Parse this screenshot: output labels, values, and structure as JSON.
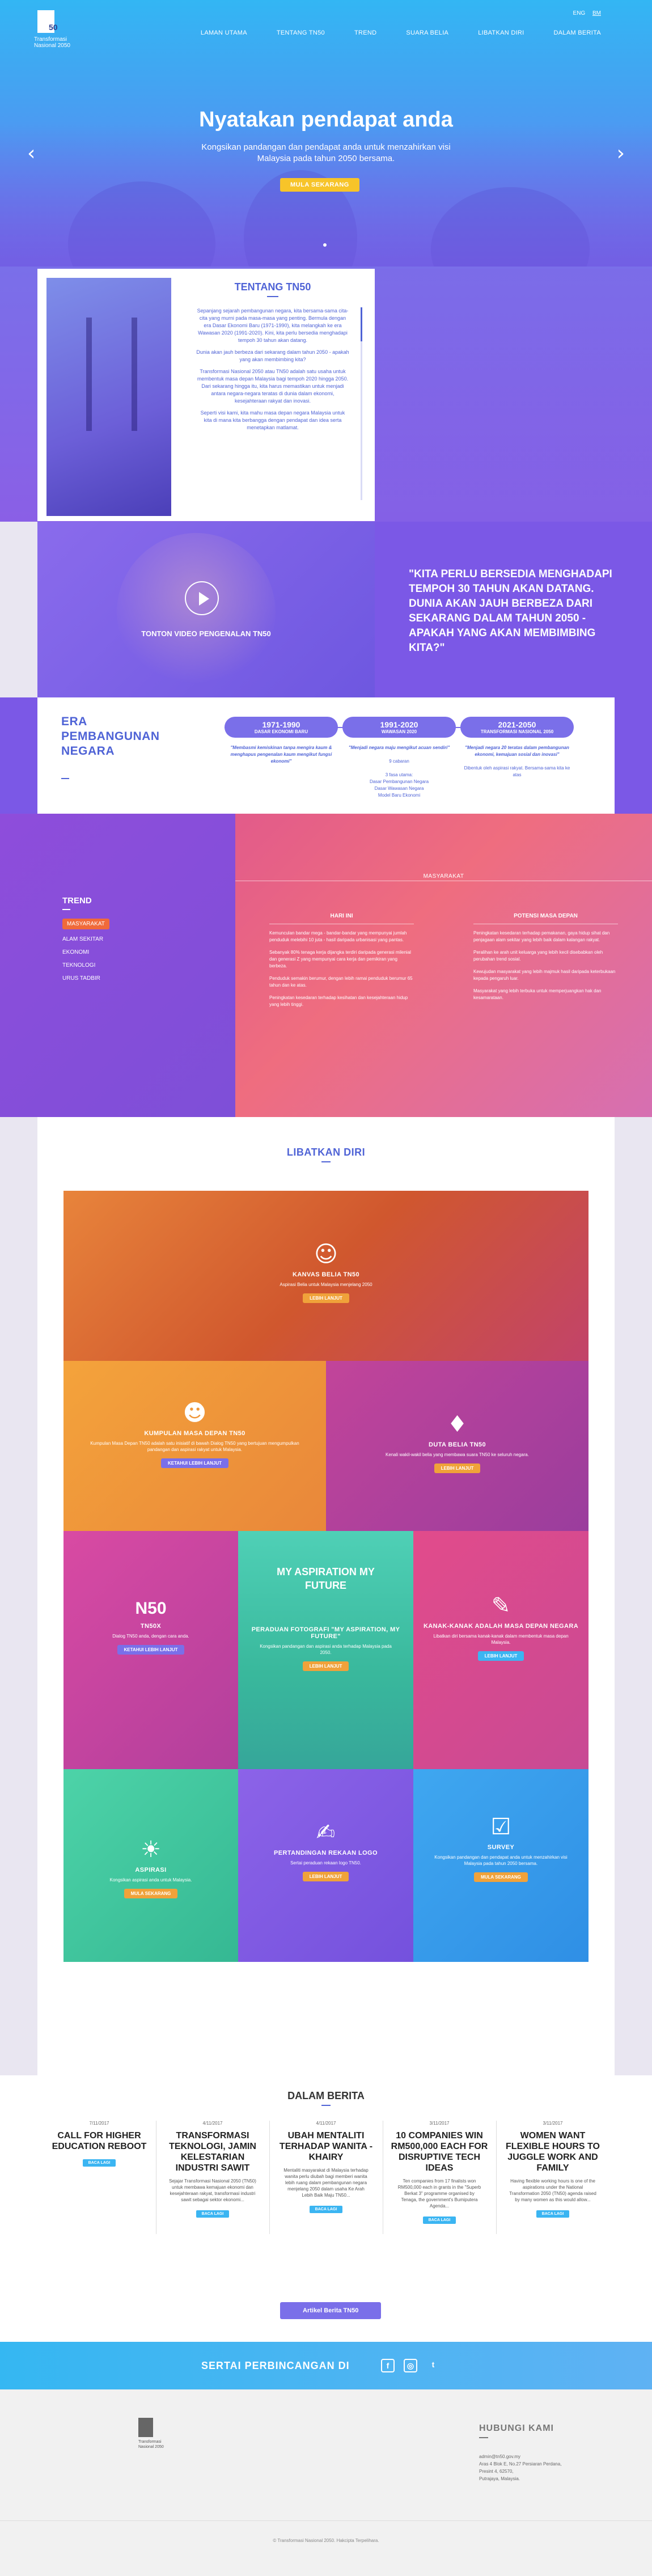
{
  "header": {
    "logo_caption": "Transformasi Nasional 2050",
    "logo_mark": "50",
    "lang": [
      "ENG",
      "BM"
    ],
    "nav": [
      "LAMAN UTAMA",
      "TENTANG TN50",
      "TREND",
      "SUARA BELIA",
      "LIBATKAN DIRI",
      "DALAM BERITA"
    ]
  },
  "hero": {
    "title": "Nyatakan pendapat anda",
    "subtitle": "Kongsikan pandangan dan pendapat anda untuk menzahirkan visi Malaysia pada tahun 2050 bersama.",
    "button": "MULA SEKARANG",
    "prev_icon": "‹",
    "next_icon": "›"
  },
  "about": {
    "title": "TENTANG TN50",
    "paragraphs": [
      "Sepanjang sejarah pembangunan negara, kita bersama-sama cita-cita yang murni pada masa-masa yang penting. Bermula dengan era Dasar Ekonomi Baru (1971-1990), kita melangkah ke era Wawasan 2020 (1991-2020). Kini, kita perlu bersedia menghadapi tempoh 30 tahun akan datang.",
      "Dunia akan jauh berbeza dari sekarang dalam tahun 2050 - apakah yang akan membimbing kita?",
      "Transformasi Nasional 2050 atau TN50 adalah satu usaha untuk membentuk masa depan Malaysia bagi tempoh 2020 hingga 2050. Dari sekarang hingga itu, kita harus memastikan untuk menjadi antara negara-negara teratas di dunia dalam ekonomi, kesejahteraan rakyat dan inovasi.",
      "Seperti visi kami, kita mahu masa depan negara Malaysia untuk kita di mana kita berbangga dengan pendapat dan idea serta menetapkan matlamat."
    ]
  },
  "video": {
    "label": "TONTON VIDEO PENGENALAN TN50"
  },
  "quote": {
    "text": "\"KITA PERLU BERSEDIA MENGHADAPI TEMPOH 30 TAHUN AKAN DATANG. DUNIA AKAN JAUH BERBEZA DARI SEKARANG DALAM TAHUN 2050 - APAKAH YANG AKAN MEMBIMBING KITA?\""
  },
  "era": {
    "title": "ERA PEMBANGUNAN NEGARA",
    "columns": [
      {
        "years": "1971-1990",
        "name": "DASAR EKONOMI BARU",
        "quote": "\"Membasmi kemiskinan tanpa mengira kaum & menghapus pengenalan kaum mengikut fungsi ekonomi\"",
        "desc": ""
      },
      {
        "years": "1991-2020",
        "name": "WAWASAN 2020",
        "quote": "\"Menjadi negara maju mengikut acuan sendiri\"",
        "desc": "9 cabaran\n\n3 fasa utama:\nDasar Pembangunan Negara\nDasar Wawasan Negara\nModel Baru Ekonomi"
      },
      {
        "years": "2021-2050",
        "name": "TRANSFORMASI NASIONAL 2050",
        "quote": "\"Menjadi negara 20 teratas dalam pembangunan ekonomi, kemajuan sosial dan inovasi\"",
        "desc": "Dibentuk oleh aspirasi rakyat. Bersama-sama kita ke atas"
      }
    ]
  },
  "trend": {
    "title": "TREND",
    "items": [
      "MASYARAKAT",
      "ALAM SEKITAR",
      "EKONOMI",
      "TEKNOLOGI",
      "URUS TADBIR"
    ],
    "active_label": "MASYARAKAT",
    "col1_title": "HARI INI",
    "col1": [
      "Kemunculan bandar mega - bandar-bandar yang mempunyai jumlah penduduk melebihi 10 juta - hasil daripada urbanisasi yang pantas.",
      "Sebanyak 80% tenaga kerja dijangka terdiri daripada generasi milenial dan generasi Z yang mempunyai cara kerja dan pemikiran yang berbeza.",
      "Penduduk semakin berumur, dengan lebih ramai penduduk berumur 65 tahun dan ke atas.",
      "Peningkatan kesedaran terhadap kesihatan dan kesejahteraan hidup yang lebih tinggi."
    ],
    "col2_title": "POTENSI MASA DEPAN",
    "col2": [
      "Peningkatan kesedaran terhadap pemakanan, gaya hidup sihat dan penjagaan alam sekitar yang lebih baik dalam kalangan rakyat.",
      "Peralihan ke arah unit keluarga yang lebih kecil disebabkan oleh perubahan trend sosial.",
      "Kewujudan masyarakat yang lebih majmuk hasil daripada keterbukaan kepada pengaruh luar.",
      "Masyarakat yang lebih terbuka untuk memperjuangkan hak dan kesamarataan."
    ]
  },
  "libatkan": {
    "title": "LIBATKAN DIRI",
    "tiles": [
      {
        "title": "KANVAS BELIA TN50",
        "desc": "Aspirasi Belia untuk Malaysia menjelang 2050",
        "button": "LEBIH LANJUT",
        "icon": "☺"
      },
      {
        "title": "KUMPULAN MASA DEPAN TN50",
        "desc": "Kumpulan Masa Depan TN50 adalah satu inisiatif di bawah Dialog TN50 yang bertujuan mengumpulkan pandangan dan aspirasi rakyat untuk Malaysia.",
        "button": "KETAHUI LEBIH LANJUT",
        "icon": "☻"
      },
      {
        "title": "DUTA BELIA TN50",
        "desc": "Kenali wakil-wakil belia yang membawa suara TN50 ke seluruh negara.",
        "button": "LEBIH LANJUT",
        "icon": "♦"
      },
      {
        "title": "TN50X",
        "desc": "Dialog TN50 anda, dengan cara anda.",
        "button": "KETAHUI LEBIH LANJUT",
        "icon": "N50"
      },
      {
        "title": "PERADUAN FOTOGRAFI \"MY ASPIRATION, MY FUTURE\"",
        "desc": "Kongsikan pandangan dan aspirasi anda terhadap Malaysia pada 2050.",
        "button": "LEBIH LANJUT",
        "icon": "MY ASPIRATION MY FUTURE"
      },
      {
        "title": "KANAK-KANAK ADALAH MASA DEPAN NEGARA",
        "desc": "Libatkan diri bersama kanak-kanak dalam membentuk masa depan Malaysia.",
        "button": "LEBIH LANJUT",
        "icon": "✎"
      },
      {
        "title": "ASPIRASI",
        "desc": "Kongsikan aspirasi anda untuk Malaysia.",
        "button": "MULA SEKARANG",
        "icon": "☀"
      },
      {
        "title": "PERTANDINGAN REKAAN LOGO",
        "desc": "Sertai peraduan rekaan logo TN50.",
        "button": "LEBIH LANJUT",
        "icon": "✍"
      },
      {
        "title": "SURVEY",
        "desc": "Kongsikan pandangan dan pendapat anda untuk menzahirkan visi Malaysia pada tahun 2050 bersama.",
        "button": "MULA SEKARANG",
        "icon": "☑"
      }
    ]
  },
  "news": {
    "title": "DALAM BERITA",
    "items": [
      {
        "date": "7/11/2017",
        "title": "CALL FOR HIGHER EDUCATION REBOOT",
        "desc": "",
        "button": "BACA LAGI"
      },
      {
        "date": "4/11/2017",
        "title": "TRANSFORMASI TEKNOLOGI, JAMIN KELESTARIAN INDUSTRI SAWIT",
        "desc": "Sejajar Transformasi Nasional 2050 (TN50) untuk membawa kemajuan ekonomi dan kesejahteraan rakyat, transformasi industri sawit sebagai sektor ekonomi...",
        "button": "BACA LAGI"
      },
      {
        "date": "4/11/2017",
        "title": "UBAH MENTALITI TERHADAP WANITA - KHAIRY",
        "desc": "Mentaliti masyarakat di Malaysia terhadap wanita perlu diubah bagi memberi wanita lebih ruang dalam pembangunan negara menjelang 2050 dalam usaha Ke Arah Lebih Baik Maju TN50...",
        "button": "BACA LAGI"
      },
      {
        "date": "3/11/2017",
        "title": "10 COMPANIES WIN RM500,000 EACH FOR DISRUPTIVE TECH IDEAS",
        "desc": "Ten companies from 17 finalists won RM500,000 each in grants in the \"Superb Berkat 3\" programme organised by Tenaga, the government's Bumiputera Agenda...",
        "button": "BACA LAGI"
      },
      {
        "date": "3/11/2017",
        "title": "WOMEN WANT FLEXIBLE HOURS TO JUGGLE WORK AND FAMILY",
        "desc": "Having flexible working hours is one of the aspirations under the National Transformation 2050 (TN50) agenda raised by many women as this would allow...",
        "button": "BACA LAGI"
      }
    ],
    "more_button": "Artikel Berita TN50"
  },
  "social": {
    "text": "SERTAI PERBINCANGAN DI",
    "icons": [
      "f",
      "◎",
      "t"
    ]
  },
  "footer": {
    "logo_caption": "Transformasi Nasional 2050",
    "contact_title": "HUBUNGI KAMI",
    "contact": "admin@tn50.gov.my\nAras 4 Blok E, No.27 Persiaran Perdana,\nPresint 4, 62570,\nPutrajaya, Malaysia.",
    "copyright": "© Transformasi Nasional 2050. Hakcipta Terpelihara."
  }
}
